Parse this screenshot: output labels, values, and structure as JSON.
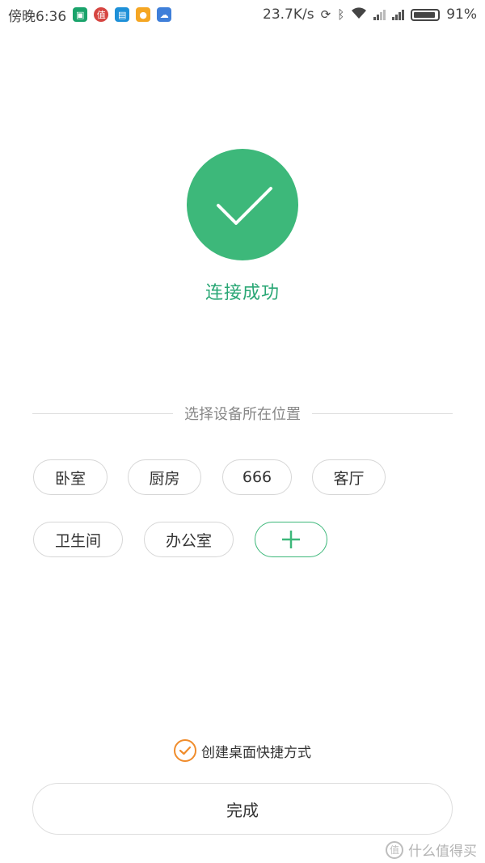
{
  "status_bar": {
    "time": "傍晚6:36",
    "network_speed": "23.7K/s",
    "battery_percent": "91%",
    "battery_level": 0.91,
    "app_icons": [
      {
        "name": "mi-home-icon",
        "color": "#1aa36b"
      },
      {
        "name": "smzdm-icon",
        "color": "#d64541"
      },
      {
        "name": "app-blue-icon",
        "color": "#1e90d8"
      },
      {
        "name": "chat-orange-icon",
        "color": "#f5a623"
      },
      {
        "name": "cloud-icon",
        "color": "#3f7fd9"
      }
    ]
  },
  "success": {
    "text": "连接成功",
    "circle_color": "#3db87a"
  },
  "location": {
    "section_label": "选择设备所在位置",
    "rooms": [
      "卧室",
      "厨房",
      "666",
      "客厅",
      "卫生间",
      "办公室"
    ],
    "add_label": "+"
  },
  "shortcut": {
    "label": "创建桌面快捷方式",
    "checked": true,
    "check_color": "#f08c2b"
  },
  "done_button": {
    "label": "完成"
  },
  "watermark": {
    "badge": "值",
    "text": "什么值得买"
  }
}
